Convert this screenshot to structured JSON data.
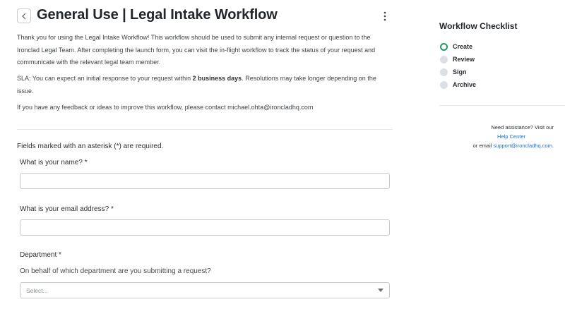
{
  "header": {
    "title": "General Use | Legal Intake Workflow"
  },
  "intro": {
    "line1": "Thank you for using the Legal Intake Workflow! This workflow should be used to submit any internal request or question to the",
    "line2": "Ironclad Legal Team. After completing the launch form, you can visit the in-flight workflow to track the status of your request and",
    "line3": "communicate with the relevant legal team member.",
    "sla_prefix": "SLA: You can expect an initial response to your request within ",
    "sla_bold": "2 business days",
    "sla_suffix": ". Resolutions may take longer depending on the",
    "sla_line2": "issue.",
    "feedback": "If you have any feedback or ideas to improve this workflow, please contact michael.ohta@ironcladhq.com"
  },
  "form": {
    "required_note": "Fields marked with an asterisk (*) are required.",
    "name_label": "What is your name? *",
    "name_value": "",
    "email_label": "What is your email address? *",
    "email_value": "",
    "department_label": "Department *",
    "department_help": "On behalf of which department are you submitting a request?",
    "department_placeholder": "Select..."
  },
  "sidebar": {
    "title": "Workflow Checklist",
    "steps": [
      {
        "label": "Create",
        "status": "active"
      },
      {
        "label": "Review",
        "status": "pending"
      },
      {
        "label": "Sign",
        "status": "pending"
      },
      {
        "label": "Archive",
        "status": "pending"
      }
    ],
    "assist_line1": "Need assistance? Visit our",
    "help_center": "Help Center",
    "email_prefix": "or email ",
    "support_email": "support@ironcladhq.com",
    "email_suffix": "."
  },
  "colors": {
    "active_step": "#1f9b63",
    "link": "#1a6fd1",
    "pending_step": "#dcdfe3"
  },
  "icons": {
    "back": "chevron-left-icon",
    "menu": "kebab-menu-icon",
    "dropdown": "caret-down-icon"
  }
}
